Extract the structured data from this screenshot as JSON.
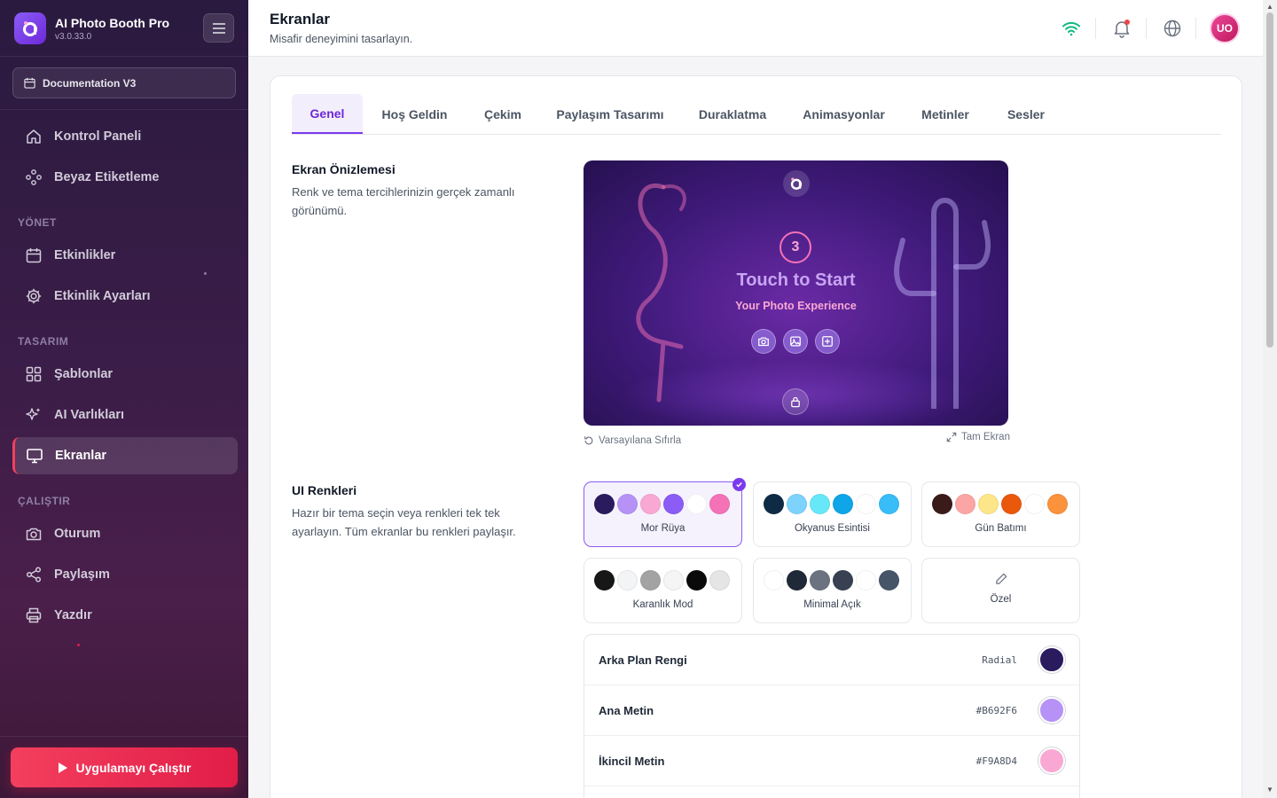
{
  "app": {
    "name": "AI Photo Booth Pro",
    "version": "v3.0.33.0"
  },
  "sidebar": {
    "doc_selector": "Documentation V3",
    "items": [
      {
        "label": "Kontrol Paneli",
        "icon": "home-icon"
      },
      {
        "label": "Beyaz Etiketleme",
        "icon": "palette-icon"
      }
    ],
    "section_manage": "YÖNET",
    "manage_items": [
      {
        "label": "Etkinlikler",
        "icon": "calendar-icon"
      },
      {
        "label": "Etkinlik Ayarları",
        "icon": "gear-icon"
      }
    ],
    "section_design": "TASARIM",
    "design_items": [
      {
        "label": "Şablonlar",
        "icon": "grid-icon"
      },
      {
        "label": "AI Varlıkları",
        "icon": "sparkles-icon"
      },
      {
        "label": "Ekranlar",
        "icon": "monitor-icon",
        "active": true
      }
    ],
    "section_run": "ÇALIŞTIR",
    "run_items": [
      {
        "label": "Oturum",
        "icon": "camera-icon"
      },
      {
        "label": "Paylaşım",
        "icon": "share-icon"
      },
      {
        "label": "Yazdır",
        "icon": "printer-icon"
      }
    ],
    "run_button": "Uygulamayı Çalıştır"
  },
  "header": {
    "title": "Ekranlar",
    "subtitle": "Misafir deneyimini tasarlayın.",
    "avatar_initials": "UO"
  },
  "tabs": [
    "Genel",
    "Hoş Geldin",
    "Çekim",
    "Paylaşım Tasarımı",
    "Duraklatma",
    "Animasyonlar",
    "Metinler",
    "Sesler"
  ],
  "active_tab": "Genel",
  "preview_section": {
    "title": "Ekran Önizlemesi",
    "description": "Renk ve tema tercihlerinizin gerçek zamanlı görünümü.",
    "countdown": "3",
    "headline": "Touch to Start",
    "subheadline": "Your Photo Experience",
    "reset_label": "Varsayılana Sıfırla",
    "fullscreen_label": "Tam Ekran"
  },
  "colors_section": {
    "title": "UI Renkleri",
    "description": "Hazır bir tema seçin veya renkleri tek tek ayarlayın. Tüm ekranlar bu renkleri paylaşır.",
    "themes": [
      {
        "name": "Mor Rüya",
        "selected": true,
        "swatches": [
          "#2a1a5e",
          "#b692f6",
          "#f9a8d4",
          "#8b5cf6",
          "#ffffff",
          "#f472b6"
        ]
      },
      {
        "name": "Okyanus Esintisi",
        "selected": false,
        "swatches": [
          "#0f2a44",
          "#7dd3fc",
          "#67e8f9",
          "#0ea5e9",
          "#ffffff",
          "#38bdf8"
        ]
      },
      {
        "name": "Gün Batımı",
        "selected": false,
        "swatches": [
          "#3b1a1a",
          "#fca5a5",
          "#fde68a",
          "#ea580c",
          "#ffffff",
          "#fb923c"
        ]
      },
      {
        "name": "Karanlık Mod",
        "selected": false,
        "swatches": [
          "#171717",
          "#f3f4f6",
          "#a3a3a3",
          "#f5f5f5",
          "#0a0a0a",
          "#e5e5e5"
        ]
      },
      {
        "name": "Minimal Açık",
        "selected": false,
        "swatches": [
          "#ffffff",
          "#1f2937",
          "#6b7280",
          "#374151",
          "#ffffff",
          "#475569"
        ]
      }
    ],
    "custom_label": "Özel",
    "rows": [
      {
        "label": "Arka Plan Rengi",
        "value": "Radial",
        "color": "#2a1a5e"
      },
      {
        "label": "Ana Metin",
        "value": "#B692F6",
        "color": "#b692f6"
      },
      {
        "label": "İkincil Metin",
        "value": "#F9A8D4",
        "color": "#f9a8d4"
      }
    ]
  }
}
